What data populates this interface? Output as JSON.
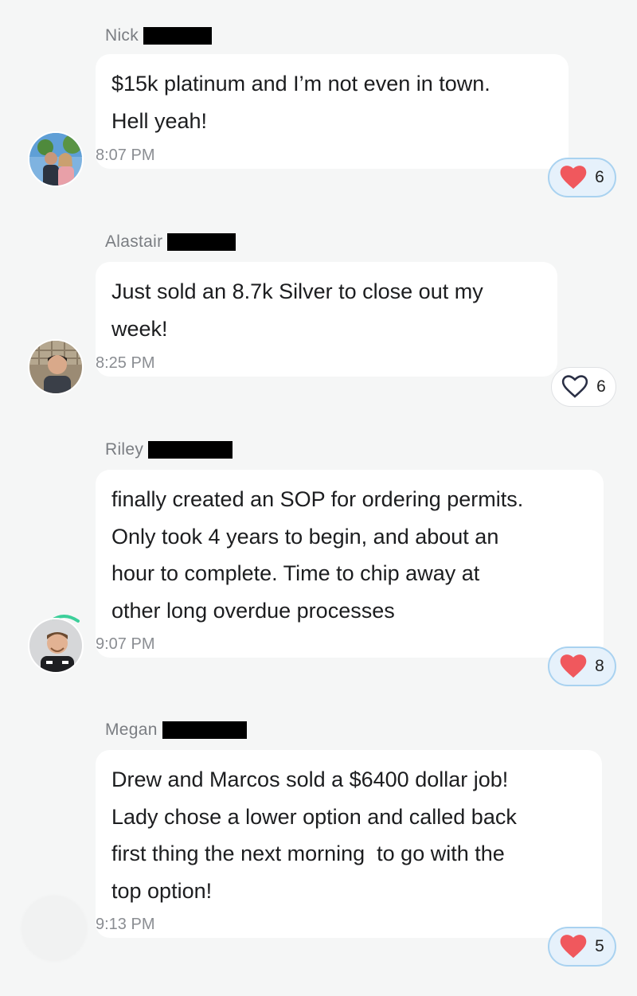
{
  "messages": [
    {
      "sender": "Nick",
      "text": "$15k platinum and I’m not even in town.\nHell yeah!",
      "time": "8:07 PM",
      "reaction": {
        "count": "6",
        "liked": true
      },
      "avatar": "avatar-nick"
    },
    {
      "sender": "Alastair",
      "text": "Just sold an 8.7k Silver to close out my\nweek!",
      "time": "8:25 PM",
      "reaction": {
        "count": "6",
        "liked": false
      },
      "avatar": "avatar-alastair"
    },
    {
      "sender": "Riley",
      "text": "finally created an SOP for ordering permits.\nOnly took 4 years to begin, and about an\nhour to complete. Time to chip away at\nother long overdue processes",
      "time": "9:07 PM",
      "reaction": {
        "count": "8",
        "liked": true
      },
      "avatar": "avatar-riley"
    },
    {
      "sender": "Megan",
      "text": "Drew and Marcos sold a $6400 dollar job!\nLady chose a lower option and called back\nfirst thing the next morning  to go with the\ntop option!",
      "time": "9:13 PM",
      "reaction": {
        "count": "5",
        "liked": true
      },
      "avatar": "avatar-megan"
    }
  ],
  "colors": {
    "heart_filled": "#f0585d",
    "heart_outline": "#2a2f45",
    "reaction_active_bg": "#e6f1fb",
    "reaction_active_border": "#a9d2f0",
    "presence_arc": "#3ccf9a"
  },
  "icons": {
    "heart_filled": "heart-filled-icon",
    "heart_outline": "heart-outline-icon"
  }
}
